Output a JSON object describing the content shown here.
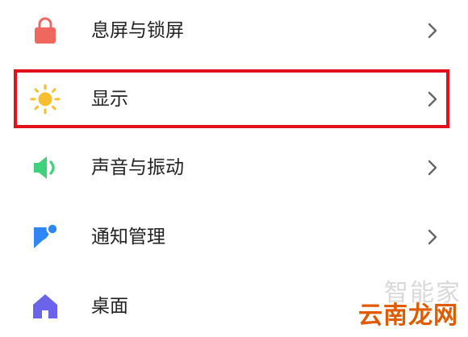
{
  "settings": {
    "items": [
      {
        "label": "息屏与锁屏",
        "icon": "lock-icon",
        "icon_color": "#f0675f"
      },
      {
        "label": "显示",
        "icon": "sun-icon",
        "icon_color": "#f7be2e"
      },
      {
        "label": "声音与振动",
        "icon": "speaker-icon",
        "icon_color": "#3fd27c"
      },
      {
        "label": "通知管理",
        "icon": "notification-icon",
        "icon_color": "#2f86f6"
      },
      {
        "label": "桌面",
        "icon": "home-icon",
        "icon_color": "#6b63e9"
      }
    ],
    "highlighted_item": "显示",
    "highlight_color": "#e3101c"
  },
  "watermark": {
    "line1": "智能家",
    "line2": "云南龙网"
  }
}
